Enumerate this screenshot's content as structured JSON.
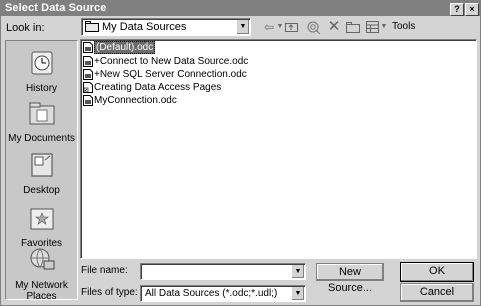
{
  "window": {
    "title": "Select Data Source",
    "help_label": "?",
    "close_label": "×"
  },
  "lookin": {
    "label": "Look in:",
    "value": "My Data Sources"
  },
  "toolbar": {
    "tools_label": "Tools"
  },
  "places": [
    {
      "label": "History"
    },
    {
      "label": "My Documents"
    },
    {
      "label": "Desktop"
    },
    {
      "label": "Favorites"
    },
    {
      "label": "My Network\nPlaces"
    }
  ],
  "files": [
    {
      "name": "(Default).odc",
      "selected": true
    },
    {
      "name": "+Connect to New Data Source.odc",
      "selected": false
    },
    {
      "name": "+New SQL Server Connection.odc",
      "selected": false
    },
    {
      "name": "Creating Data Access Pages",
      "selected": false
    },
    {
      "name": "MyConnection.odc",
      "selected": false
    }
  ],
  "filename": {
    "label": "File name:",
    "value": ""
  },
  "filetype": {
    "label": "Files of type:",
    "value": "All Data Sources (*.odc;*.udl;)"
  },
  "buttons": {
    "new_source": "New Source...",
    "ok": "OK",
    "cancel": "Cancel"
  }
}
